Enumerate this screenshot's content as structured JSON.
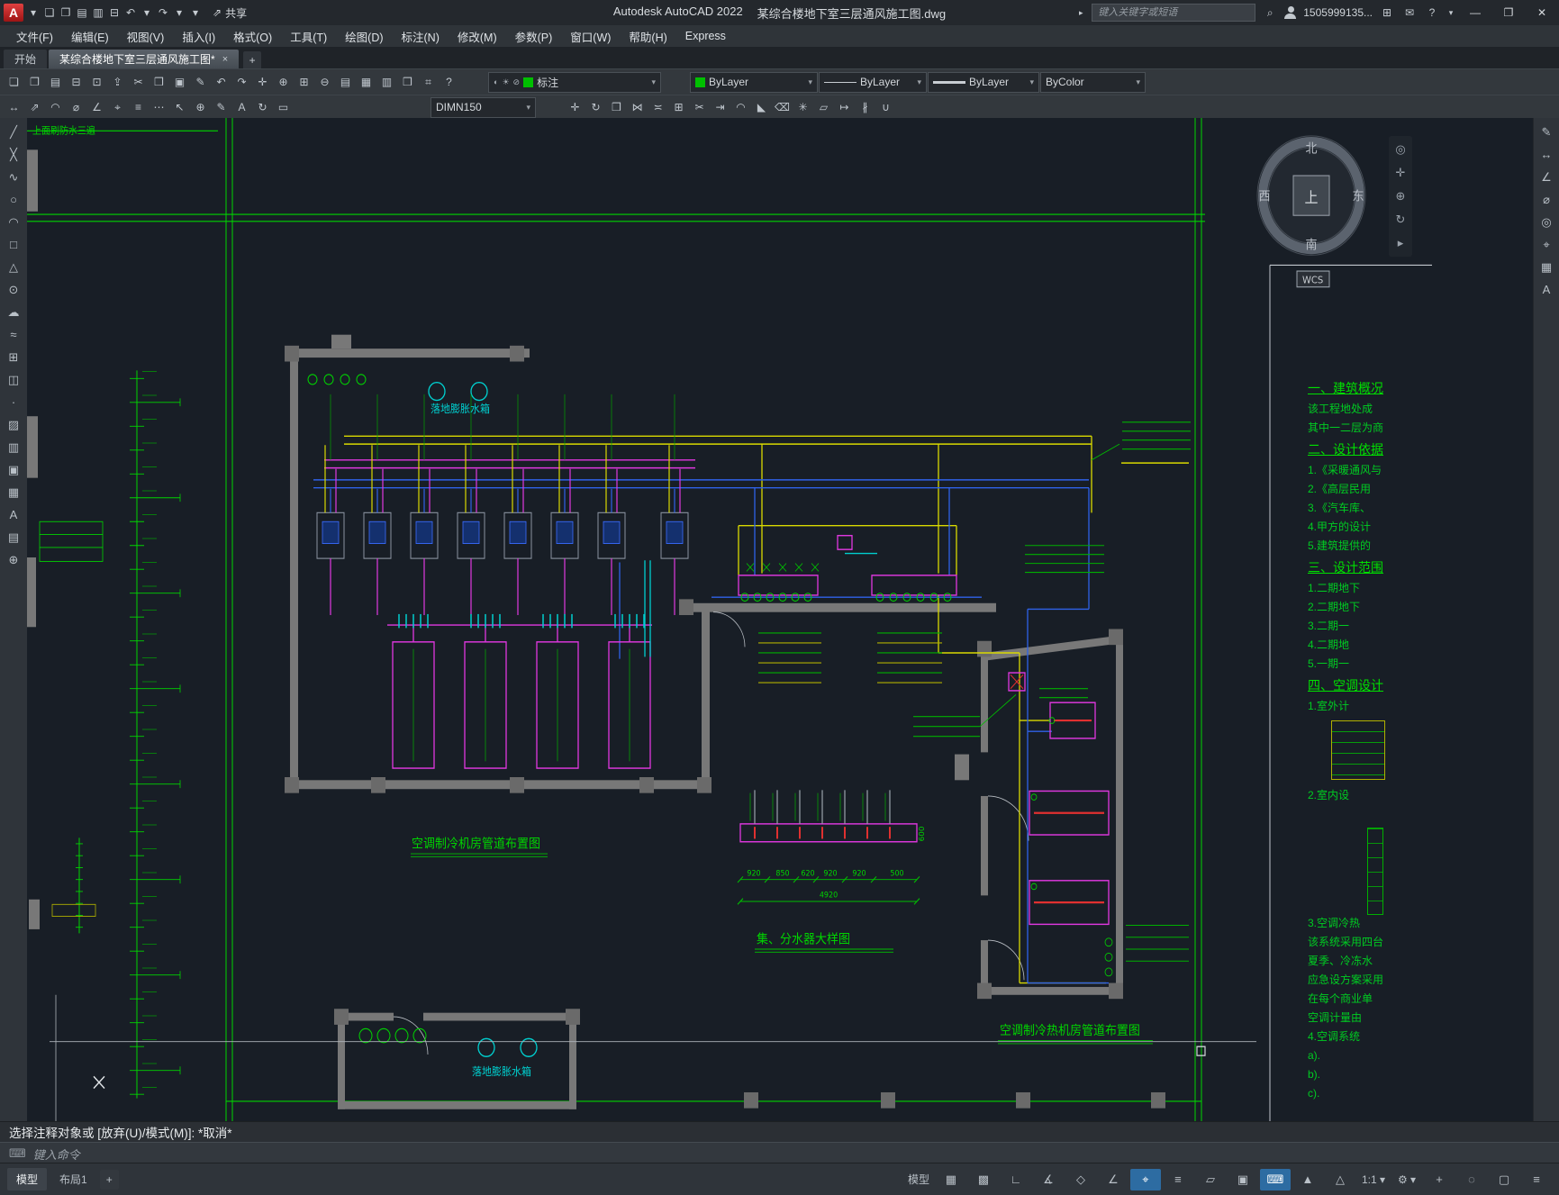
{
  "ui": {
    "caret": "▾"
  },
  "accent_colors": {
    "layer_green": "#00c000",
    "active_blue": "#2d6ca2",
    "pipe_yellow": "#d9d900",
    "pipe_blue": "#2f62e8",
    "pipe_magenta": "#e038e0",
    "pipe_cyan": "#00cfcf",
    "line_green": "#00d400"
  },
  "titlebar": {
    "app_title": "Autodesk AutoCAD 2022",
    "doc_title": "某综合楼地下室三层通风施工图.dwg",
    "share_label": "共享",
    "share_icon": "⇗",
    "search_placeholder": "键入关键字或短语",
    "search_nav_icon": "▸",
    "search_icon": "⌕",
    "username": "1505999135...",
    "cart_icon": "⊞",
    "inbox_icon": "✉",
    "help_label": "?",
    "window": {
      "minimize": "—",
      "maximize": "❐",
      "close": "✕"
    },
    "quick_icons": [
      {
        "name": "app-menu-caret",
        "glyph": "▾"
      },
      {
        "name": "qat-new-icon",
        "glyph": "❏"
      },
      {
        "name": "qat-open-icon",
        "glyph": "❐"
      },
      {
        "name": "qat-save-icon",
        "glyph": "▤"
      },
      {
        "name": "qat-saveas-icon",
        "glyph": "▥"
      },
      {
        "name": "qat-plot-icon",
        "glyph": "⊟"
      },
      {
        "name": "qat-undo-icon",
        "glyph": "↶"
      },
      {
        "name": "qat-undo-caret",
        "glyph": "▾"
      },
      {
        "name": "qat-redo-icon",
        "glyph": "↷"
      },
      {
        "name": "qat-redo-caret",
        "glyph": "▾"
      },
      {
        "name": "qat-customize-caret",
        "glyph": "▾"
      }
    ]
  },
  "menu": {
    "items": [
      {
        "name": "menu-file",
        "label": "文件(F)"
      },
      {
        "name": "menu-edit",
        "label": "编辑(E)"
      },
      {
        "name": "menu-view",
        "label": "视图(V)"
      },
      {
        "name": "menu-insert",
        "label": "插入(I)"
      },
      {
        "name": "menu-format",
        "label": "格式(O)"
      },
      {
        "name": "menu-tools",
        "label": "工具(T)"
      },
      {
        "name": "menu-draw",
        "label": "绘图(D)"
      },
      {
        "name": "menu-dimension",
        "label": "标注(N)"
      },
      {
        "name": "menu-modify",
        "label": "修改(M)"
      },
      {
        "name": "menu-parametric",
        "label": "参数(P)"
      },
      {
        "name": "menu-window",
        "label": "窗口(W)"
      },
      {
        "name": "menu-help",
        "label": "帮助(H)"
      },
      {
        "name": "menu-express",
        "label": "Express"
      }
    ]
  },
  "tabs": {
    "start": "开始",
    "doc": "某综合楼地下室三层通风施工图*",
    "close_glyph": "×",
    "add_glyph": "+"
  },
  "toolbar1": {
    "icons": [
      {
        "name": "qnew-icon",
        "glyph": "❏"
      },
      {
        "name": "open-icon",
        "glyph": "❐"
      },
      {
        "name": "save-icon",
        "glyph": "▤"
      },
      {
        "name": "plot-icon",
        "glyph": "⊟"
      },
      {
        "name": "plot-preview-icon",
        "glyph": "⊡"
      },
      {
        "name": "publish-icon",
        "glyph": "⇪"
      },
      {
        "name": "cut-icon",
        "glyph": "✂"
      },
      {
        "name": "copy-icon",
        "glyph": "❒"
      },
      {
        "name": "paste-icon",
        "glyph": "▣"
      },
      {
        "name": "match-properties-icon",
        "glyph": "✎"
      },
      {
        "name": "undo-icon",
        "glyph": "↶"
      },
      {
        "name": "redo-icon",
        "glyph": "↷"
      },
      {
        "name": "pan-icon",
        "glyph": "✛"
      },
      {
        "name": "zoom-realtime-icon",
        "glyph": "⊕"
      },
      {
        "name": "zoom-window-icon",
        "glyph": "⊞"
      },
      {
        "name": "zoom-previous-icon",
        "glyph": "⊖"
      },
      {
        "name": "properties-icon",
        "glyph": "▤"
      },
      {
        "name": "designcenter-icon",
        "glyph": "▦"
      },
      {
        "name": "tool-palettes-icon",
        "glyph": "▥"
      },
      {
        "name": "sheet-set-icon",
        "glyph": "❒"
      },
      {
        "name": "calculator-icon",
        "glyph": "⌗"
      },
      {
        "name": "help-icon",
        "glyph": "?"
      }
    ],
    "layer": {
      "name": "标注",
      "status_glyphs": [
        "◐",
        "☀",
        "⊘"
      ]
    },
    "color": "ByLayer",
    "linetype": "ByLayer",
    "lineweight": "ByLayer",
    "plotstyle": "ByColor"
  },
  "toolbar2": {
    "left_icons": [
      {
        "name": "dim-linear-icon",
        "glyph": "↔"
      },
      {
        "name": "dim-aligned-icon",
        "glyph": "⇗"
      },
      {
        "name": "dim-arc-icon",
        "glyph": "◠"
      },
      {
        "name": "dim-radius-icon",
        "glyph": "⌀"
      },
      {
        "name": "dim-angular-icon",
        "glyph": "∠"
      },
      {
        "name": "dim-center-icon",
        "glyph": "⌖"
      },
      {
        "name": "dim-baseline-icon",
        "glyph": "≡"
      },
      {
        "name": "dim-continue-icon",
        "glyph": "⋯"
      },
      {
        "name": "leader-icon",
        "glyph": "↖"
      },
      {
        "name": "tolerance-icon",
        "glyph": "⊕"
      },
      {
        "name": "dim-edit-icon",
        "glyph": "✎"
      },
      {
        "name": "dim-text-edit-icon",
        "glyph": "A"
      },
      {
        "name": "dim-update-icon",
        "glyph": "↻"
      },
      {
        "name": "dim-style-icon",
        "glyph": "▭"
      }
    ],
    "dimstyle": "DIMN150",
    "right_icons": [
      {
        "name": "move-icon",
        "glyph": "✛"
      },
      {
        "name": "rotate-icon",
        "glyph": "↻"
      },
      {
        "name": "copy-object-icon",
        "glyph": "❒"
      },
      {
        "name": "mirror-icon",
        "glyph": "⋈"
      },
      {
        "name": "offset-icon",
        "glyph": "≍"
      },
      {
        "name": "array-icon",
        "glyph": "⊞"
      },
      {
        "name": "trim-icon",
        "glyph": "✂"
      },
      {
        "name": "extend-icon",
        "glyph": "⇥"
      },
      {
        "name": "fillet-icon",
        "glyph": "◠"
      },
      {
        "name": "chamfer-icon",
        "glyph": "◣"
      },
      {
        "name": "erase-icon",
        "glyph": "⌫"
      },
      {
        "name": "explode-icon",
        "glyph": "✳"
      },
      {
        "name": "scale-icon",
        "glyph": "▱"
      },
      {
        "name": "stretch-icon",
        "glyph": "↦"
      },
      {
        "name": "break-icon",
        "glyph": "∦"
      },
      {
        "name": "join-icon",
        "glyph": "∪"
      }
    ]
  },
  "left_palette": [
    {
      "name": "line-icon",
      "glyph": "╱"
    },
    {
      "name": "construction-line-icon",
      "glyph": "╳"
    },
    {
      "name": "polyline-icon",
      "glyph": "∿"
    },
    {
      "name": "circle-icon",
      "glyph": "○"
    },
    {
      "name": "arc-icon",
      "glyph": "◠"
    },
    {
      "name": "rectangle-icon",
      "glyph": "□"
    },
    {
      "name": "polygon-icon",
      "glyph": "△"
    },
    {
      "name": "ellipse-icon",
      "glyph": "⊙"
    },
    {
      "name": "revcloud-icon",
      "glyph": "☁"
    },
    {
      "name": "spline-icon",
      "glyph": "≈"
    },
    {
      "name": "insert-block-icon",
      "glyph": "⊞"
    },
    {
      "name": "create-block-icon",
      "glyph": "◫"
    },
    {
      "name": "point-icon",
      "glyph": "·"
    },
    {
      "name": "hatch-icon",
      "glyph": "▨"
    },
    {
      "name": "gradient-icon",
      "glyph": "▥"
    },
    {
      "name": "region-icon",
      "glyph": "▣"
    },
    {
      "name": "table-icon",
      "glyph": "▦"
    },
    {
      "name": "mtext-icon",
      "glyph": "A"
    },
    {
      "name": "image-icon",
      "glyph": "▤"
    },
    {
      "name": "measure-icon",
      "glyph": "⊕"
    }
  ],
  "right_palette": [
    {
      "name": "sketch-icon",
      "glyph": "✎"
    },
    {
      "name": "dim-linear-icon",
      "glyph": "↔"
    },
    {
      "name": "dim-angular-icon",
      "glyph": "∠"
    },
    {
      "name": "dim-diameter-icon",
      "glyph": "⌀"
    },
    {
      "name": "center-mark-icon",
      "glyph": "◎"
    },
    {
      "name": "mleader-icon",
      "glyph": "⌖"
    },
    {
      "name": "table-icon",
      "glyph": "▦"
    },
    {
      "name": "text-style-icon",
      "glyph": "A"
    }
  ],
  "navbar": [
    {
      "name": "steering-wheel-icon",
      "glyph": "◎"
    },
    {
      "name": "pan-hand-icon",
      "glyph": "✛"
    },
    {
      "name": "zoom-icon",
      "glyph": "⊕"
    },
    {
      "name": "orbit-icon",
      "glyph": "↻"
    },
    {
      "name": "showmotion-icon",
      "glyph": "▸"
    }
  ],
  "drawing": {
    "top_note": "上面刷防水三遍",
    "wcs_label": "WCS",
    "compass": {
      "north": "北",
      "south": "南",
      "west": "西",
      "east": "东",
      "center": "上"
    },
    "labels": {
      "tank_top": "落地膨胀水箱",
      "tank_bottom": "落地膨胀水箱"
    },
    "titles": {
      "plant_room": "空调制冷机房管道布置图",
      "manifold": "集、分水器大样图",
      "heat_room": "空调制冷热机房管道布置图"
    },
    "dimensions": {
      "segments": [
        "920",
        "850",
        "620",
        "920",
        "920",
        "500"
      ],
      "total": "4920",
      "side": "600"
    },
    "notes": [
      {
        "text": "一、建筑概况",
        "cls": "h"
      },
      {
        "text": "该工程地处成"
      },
      {
        "text": "其中一二层为商"
      },
      {
        "text": "二、设计依据",
        "cls": "h"
      },
      {
        "text": "1.《采暖通风与"
      },
      {
        "text": "2.《高层民用"
      },
      {
        "text": "3.《汽车库、"
      },
      {
        "text": "4.甲方的设计"
      },
      {
        "text": "5.建筑提供的"
      },
      {
        "text": "三、设计范围",
        "cls": "h"
      },
      {
        "text": "1.二期地下"
      },
      {
        "text": "2.二期地下"
      },
      {
        "text": "3.二期一"
      },
      {
        "text": "4.二期地"
      },
      {
        "text": "5.一期一"
      },
      {
        "text": "四、空调设计",
        "cls": "h"
      },
      {
        "text": "1.室外计"
      },
      {
        "text": "2.室内设",
        "cls": "sp1"
      },
      {
        "text": "3.空调冷热",
        "cls": "sp2"
      },
      {
        "text": "该系统采用四台"
      },
      {
        "text": "夏季、冷冻水"
      },
      {
        "text": "应急设方案采用"
      },
      {
        "text": "在每个商业单"
      },
      {
        "text": "空调计量由"
      },
      {
        "text": "4.空调系统"
      },
      {
        "text": "a)."
      },
      {
        "text": "b)."
      },
      {
        "text": "c)."
      }
    ]
  },
  "command": {
    "history": "选择注释对象或 [放弃(U)/模式(M)]: *取消*",
    "placeholder": "键入命令",
    "prompt_icon": "⌨"
  },
  "statusbar": {
    "model_tab": "模型",
    "layout_tab": "布局1",
    "add_tab": "+",
    "items": [
      {
        "name": "model-space-toggle",
        "glyph": "模型",
        "cls": "txt"
      },
      {
        "name": "grid-icon",
        "glyph": "▦"
      },
      {
        "name": "snap-icon",
        "glyph": "▩"
      },
      {
        "name": "ortho-icon",
        "glyph": "∟"
      },
      {
        "name": "polar-icon",
        "glyph": "∡"
      },
      {
        "name": "isodraft-icon",
        "glyph": "◇"
      },
      {
        "name": "otrack-icon",
        "glyph": "∠"
      },
      {
        "name": "osnap-icon",
        "glyph": "⌖",
        "cls": "active"
      },
      {
        "name": "lineweight-icon",
        "glyph": "≡"
      },
      {
        "name": "transparency-icon",
        "glyph": "▱"
      },
      {
        "name": "selection-cycling-icon",
        "glyph": "▣"
      },
      {
        "name": "dyninput-icon",
        "glyph": "⌨",
        "cls": "active"
      },
      {
        "name": "annotation-visibility-icon",
        "glyph": "▲"
      },
      {
        "name": "autoscale-icon",
        "glyph": "△"
      },
      {
        "name": "annotation-scale",
        "glyph": "1:1 ▾",
        "cls": "txt"
      },
      {
        "name": "workspace-gear-icon",
        "glyph": "⚙ ▾",
        "cls": "txt"
      },
      {
        "name": "annotation-monitor-icon",
        "glyph": "+"
      },
      {
        "name": "isolate-objects-icon",
        "glyph": "◌"
      },
      {
        "name": "clean-screen-icon",
        "glyph": "▢"
      },
      {
        "name": "customize-icon",
        "glyph": "≡"
      }
    ]
  }
}
